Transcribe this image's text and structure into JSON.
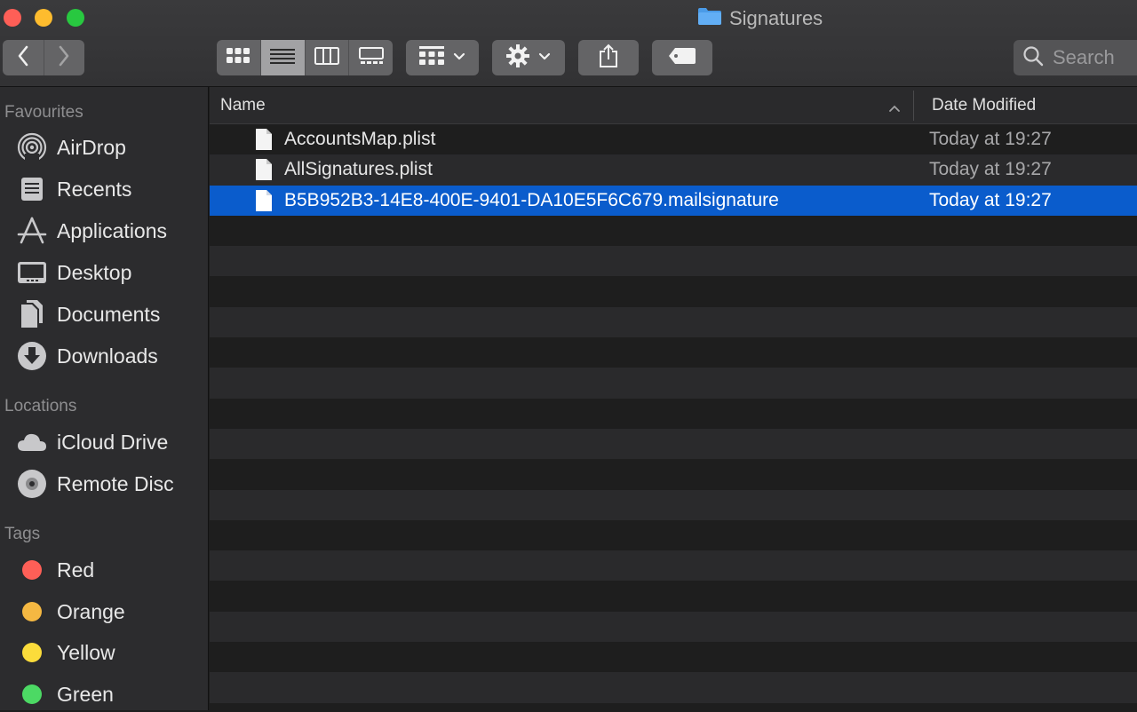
{
  "window": {
    "title": "Signatures"
  },
  "toolbar": {
    "search_placeholder": "Search"
  },
  "sidebar": {
    "favourites_title": "Favourites",
    "favourites": [
      {
        "label": "AirDrop",
        "icon": "airdrop-icon"
      },
      {
        "label": "Recents",
        "icon": "recents-icon"
      },
      {
        "label": "Applications",
        "icon": "applications-icon"
      },
      {
        "label": "Desktop",
        "icon": "desktop-icon"
      },
      {
        "label": "Documents",
        "icon": "documents-icon"
      },
      {
        "label": "Downloads",
        "icon": "downloads-icon"
      }
    ],
    "locations_title": "Locations",
    "locations": [
      {
        "label": "iCloud Drive",
        "icon": "cloud-icon"
      },
      {
        "label": "Remote Disc",
        "icon": "disc-icon"
      }
    ],
    "tags_title": "Tags",
    "tags": [
      {
        "label": "Red",
        "color": "#fe5f57"
      },
      {
        "label": "Orange",
        "color": "#f5b842"
      },
      {
        "label": "Yellow",
        "color": "#fbdc3b"
      },
      {
        "label": "Green",
        "color": "#4cd964"
      }
    ]
  },
  "list": {
    "columns": {
      "name": "Name",
      "date": "Date Modified"
    },
    "files": [
      {
        "name": "AccountsMap.plist",
        "date": "Today at 19:27",
        "selected": false
      },
      {
        "name": "AllSignatures.plist",
        "date": "Today at 19:27",
        "selected": false
      },
      {
        "name": "B5B952B3-14E8-400E-9401-DA10E5F6C679.mailsignature",
        "date": "Today at 19:27",
        "selected": true
      }
    ],
    "selection_color": "#0a5ccc"
  }
}
